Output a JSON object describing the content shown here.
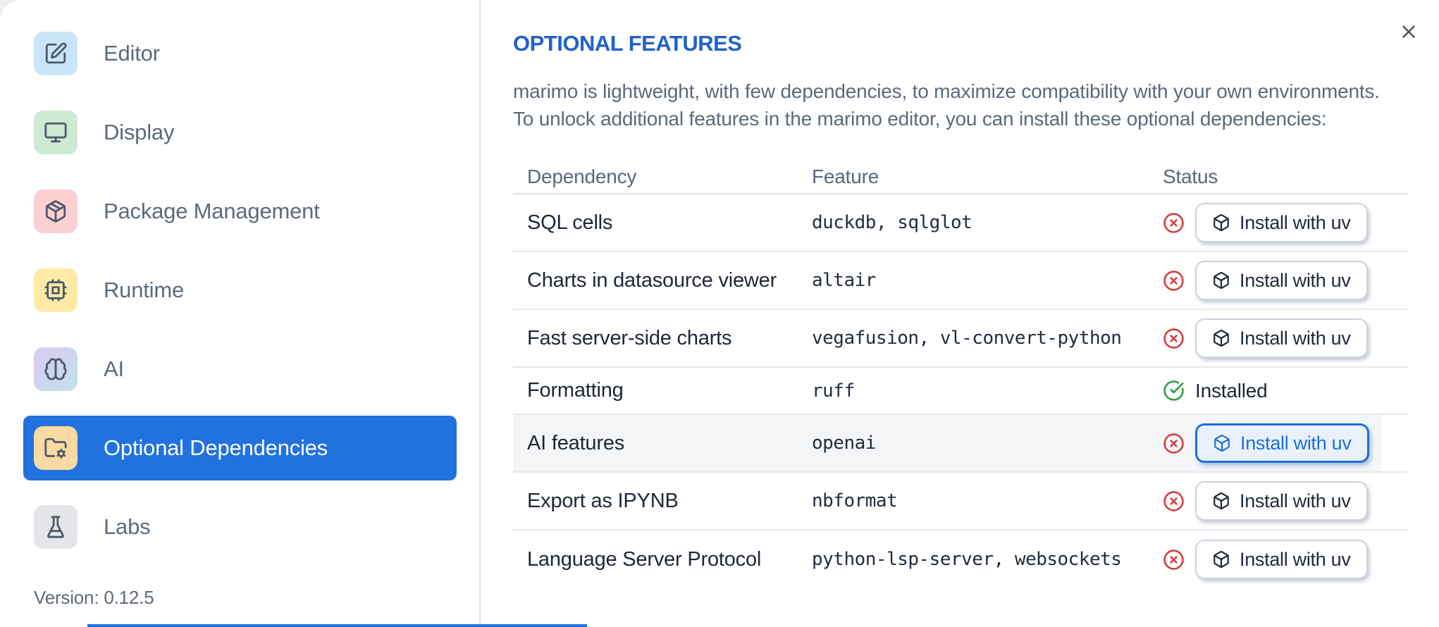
{
  "sidebar": {
    "items": [
      {
        "label": "Editor",
        "icon": "square-pen",
        "icon_bg": "#cbe5f8",
        "selected": false
      },
      {
        "label": "Display",
        "icon": "monitor",
        "icon_bg": "#cfead2",
        "selected": false
      },
      {
        "label": "Package Management",
        "icon": "package",
        "icon_bg": "#fbd0d1",
        "selected": false
      },
      {
        "label": "Runtime",
        "icon": "cpu",
        "icon_bg": "#fdeaa4",
        "selected": false
      },
      {
        "label": "AI",
        "icon": "brain",
        "icon_bg": "linear-gradient(135deg,#dac9ef 0%,#c2e2ee 100%)",
        "selected": false
      },
      {
        "label": "Optional Dependencies",
        "icon": "folder-cog",
        "icon_bg": "#fbd9a2",
        "selected": true
      },
      {
        "label": "Labs",
        "icon": "flask-conical",
        "icon_bg": "#e4e5e8",
        "selected": false
      }
    ],
    "version_label": "Version: 0.12.5"
  },
  "main": {
    "title": "OPTIONAL FEATURES",
    "description_line1": "marimo is lightweight, with few dependencies, to maximize compatibility with your own environments.",
    "description_line2": "To unlock additional features in the marimo editor, you can install these optional dependencies:",
    "table": {
      "columns": [
        "Dependency",
        "Feature",
        "Status"
      ],
      "install_button_label": "Install with uv",
      "installed_label": "Installed",
      "rows": [
        {
          "dependency": "SQL cells",
          "feature": "duckdb, sqlglot",
          "installed": false,
          "highlighted": false,
          "focused": false
        },
        {
          "dependency": "Charts in datasource viewer",
          "feature": "altair",
          "installed": false,
          "highlighted": false,
          "focused": false
        },
        {
          "dependency": "Fast server-side charts",
          "feature": "vegafusion, vl-convert-python",
          "installed": false,
          "highlighted": false,
          "focused": false
        },
        {
          "dependency": "Formatting",
          "feature": "ruff",
          "installed": true,
          "highlighted": false,
          "focused": false
        },
        {
          "dependency": "AI features",
          "feature": "openai",
          "installed": false,
          "highlighted": true,
          "focused": true
        },
        {
          "dependency": "Export as IPYNB",
          "feature": "nbformat",
          "installed": false,
          "highlighted": false,
          "focused": false
        },
        {
          "dependency": "Language Server Protocol",
          "feature": "python-lsp-server, websockets",
          "installed": false,
          "highlighted": false,
          "focused": false
        }
      ]
    }
  },
  "icons": {
    "close": "x-icon",
    "not_installed": "circle-x-icon",
    "installed": "circle-check-icon",
    "install_button": "package-box-icon"
  },
  "colors": {
    "selected_item_blue": "#2172de",
    "title_blue": "#2161ca",
    "status_red": "#d43c3c",
    "status_green": "#2e9c45",
    "focus_blue": "#1e6fd9",
    "sidebar_label": "#5c6a7d",
    "cell_text": "#1e2735"
  }
}
